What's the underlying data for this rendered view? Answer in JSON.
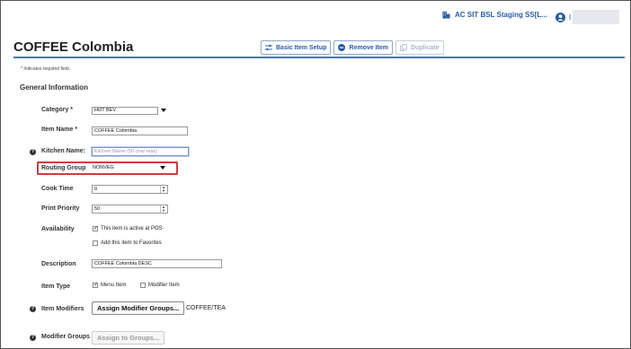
{
  "topbar": {
    "store_name": "AC SIT BSL Staging SS[L...",
    "user_initial": "I"
  },
  "header": {
    "title": "COFFEE Colombia",
    "buttons": {
      "basic_item_setup": "Basic Item Setup",
      "remove_item": "Remove Item",
      "duplicate": "Duplicate"
    }
  },
  "required_note": "* Indicates required field.",
  "section_title": "General Information",
  "form": {
    "category": {
      "label": "Category *",
      "value": "HOT BEV"
    },
    "item_name": {
      "label": "Item Name *",
      "value": "COFFEE Colombia"
    },
    "kitchen_name": {
      "label": "Kitchen Name:",
      "placeholder": "Kitchen Name (50 char max)",
      "value": ""
    },
    "routing_group": {
      "label": "Routing Group",
      "value": "NONVEG"
    },
    "cook_time": {
      "label": "Cook Time",
      "value": "0"
    },
    "print_priority": {
      "label": "Print Priority",
      "value": "50"
    },
    "availability": {
      "label": "Availability",
      "options": [
        {
          "label": "This item is active at POS",
          "checked": true
        },
        {
          "label": "Add this item to Favorites",
          "checked": false
        }
      ]
    },
    "description": {
      "label": "Description",
      "value": "COFFEE Colombia DESC"
    },
    "item_type": {
      "label": "Item Type",
      "options": [
        {
          "label": "Menu Item",
          "checked": true
        },
        {
          "label": "Modifier Item",
          "checked": false
        }
      ]
    },
    "item_modifiers": {
      "label": "Item Modifiers",
      "button": "Assign Modifier Groups...",
      "value": "COFFEE/TEA"
    },
    "modifier_groups": {
      "label": "Modifier Groups",
      "button": "Assign to Groups..."
    }
  },
  "icons": {
    "store": "building-icon",
    "user": "user-avatar-icon",
    "help": "help-icon"
  },
  "colors": {
    "accent": "#2a5aa8",
    "rule": "#4a74b5",
    "highlight": "#d13c3c"
  }
}
